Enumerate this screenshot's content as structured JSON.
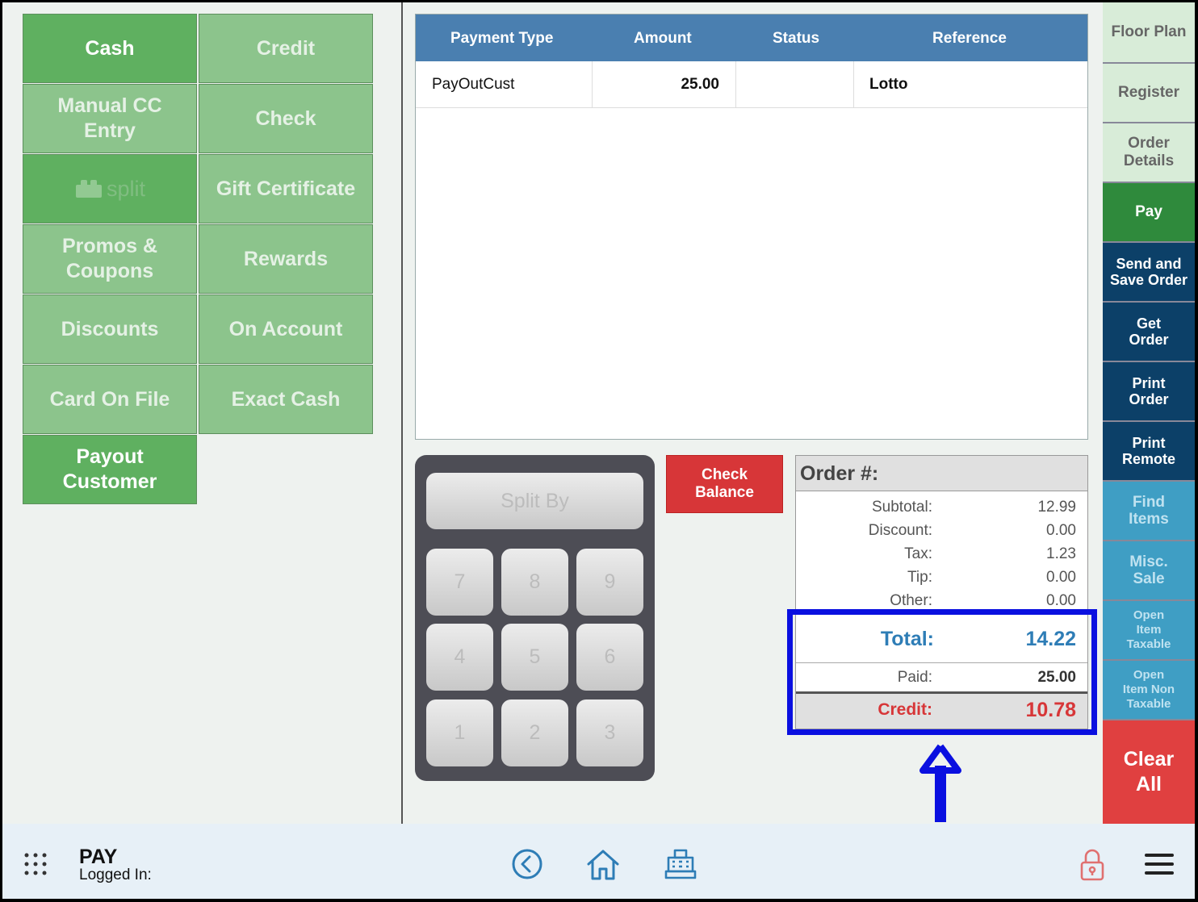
{
  "payment_buttons": {
    "cash": "Cash",
    "credit": "Credit",
    "manual_cc_line1": "Manual CC",
    "manual_cc_line2": "Entry",
    "check": "Check",
    "split_logo": "split",
    "gift_certificate": "Gift Certificate",
    "promos_line1": "Promos &",
    "promos_line2": "Coupons",
    "rewards": "Rewards",
    "discounts": "Discounts",
    "on_account": "On Account",
    "card_on_file": "Card On File",
    "exact_cash": "Exact Cash",
    "payout_line1": "Payout",
    "payout_line2": "Customer"
  },
  "payments_table": {
    "headers": [
      "Payment Type",
      "Amount",
      "Status",
      "Reference"
    ],
    "rows": [
      {
        "type": "PayOutCust",
        "amount": "25.00",
        "status": "",
        "reference": "Lotto"
      }
    ]
  },
  "keypad": {
    "split_by": "Split By",
    "keys": [
      "7",
      "8",
      "9",
      "4",
      "5",
      "6",
      "1",
      "2",
      "3"
    ]
  },
  "check_balance": {
    "line1": "Check",
    "line2": "Balance"
  },
  "order": {
    "title": "Order #:",
    "subtotal_label": "Subtotal:",
    "subtotal": "12.99",
    "discount_label": "Discount:",
    "discount": "0.00",
    "tax_label": "Tax:",
    "tax": "1.23",
    "tip_label": "Tip:",
    "tip": "0.00",
    "other_label": "Other:",
    "other": "0.00",
    "total_label": "Total:",
    "total": "14.22",
    "paid_label": "Paid:",
    "paid": "25.00",
    "credit_label": "Credit:",
    "credit": "10.78"
  },
  "nav": {
    "floor_plan": "Floor Plan",
    "register": "Register",
    "order_details_1": "Order",
    "order_details_2": "Details",
    "pay": "Pay",
    "send_save_1": "Send and",
    "send_save_2": "Save Order",
    "get_order_1": "Get",
    "get_order_2": "Order",
    "print_order_1": "Print",
    "print_order_2": "Order",
    "print_remote_1": "Print",
    "print_remote_2": "Remote",
    "find_items_1": "Find",
    "find_items_2": "Items",
    "misc_sale_1": "Misc.",
    "misc_sale_2": "Sale",
    "open_taxable_1": "Open",
    "open_taxable_2": "Item",
    "open_taxable_3": "Taxable",
    "open_nontax_1": "Open",
    "open_nontax_2": "Item Non",
    "open_nontax_3": "Taxable",
    "clear_all_1": "Clear",
    "clear_all_2": "All"
  },
  "bottom": {
    "screen_name": "PAY",
    "logged_in": "Logged In:"
  },
  "colors": {
    "accent_green": "#5fb060",
    "table_header": "#4a7fb0",
    "total_blue": "#2e7db6",
    "credit_red": "#d73638",
    "highlight": "#0a10e0"
  },
  "icons": [
    "apps-grid-icon",
    "back-circle-icon",
    "home-icon",
    "cash-register-icon",
    "lock-icon",
    "menu-icon",
    "arrow-up-icon"
  ]
}
